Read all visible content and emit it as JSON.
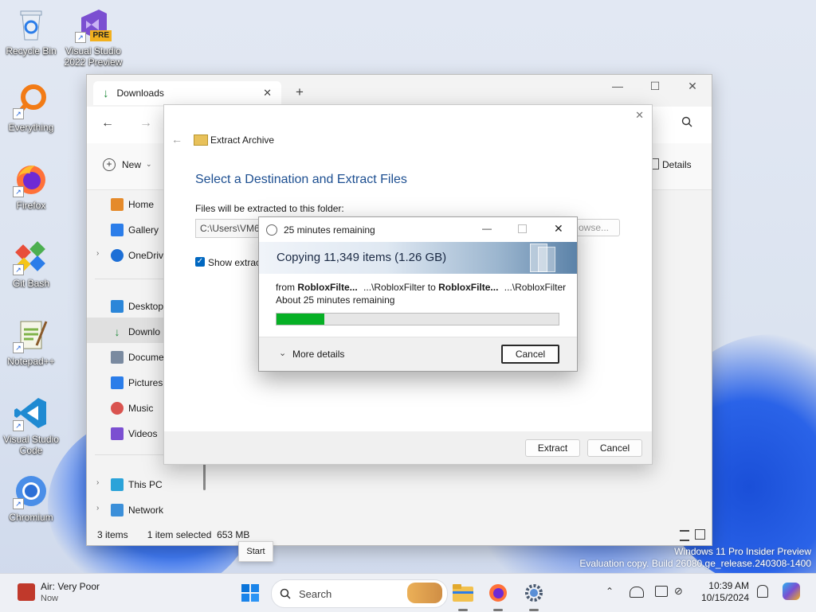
{
  "desktop": {
    "icons": [
      {
        "label": "Recycle Bin"
      },
      {
        "label": "Visual Studio 2022 Preview",
        "badge": "PRE"
      },
      {
        "label": "Everything"
      },
      {
        "label": "Firefox"
      },
      {
        "label": "Git Bash"
      },
      {
        "label": "Notepad++"
      },
      {
        "label": "Visual Studio Code"
      },
      {
        "label": "Chromium"
      }
    ],
    "watermark_line1": "Windows 11 Pro Insider Preview",
    "watermark_line2": "Evaluation copy. Build 26080.ge_release.240308-1400"
  },
  "explorer": {
    "tab_title": "Downloads",
    "new_tab": "+",
    "controls": {
      "minimize": "—",
      "maximize": "☐",
      "close": "✕"
    },
    "new_label": "New",
    "details_label": "Details",
    "sidebar": [
      {
        "label": "Home"
      },
      {
        "label": "Gallery"
      },
      {
        "label": "OneDriv"
      },
      {
        "label": "Desktop"
      },
      {
        "label": "Downlo"
      },
      {
        "label": "Docume"
      },
      {
        "label": "Pictures"
      },
      {
        "label": "Music"
      },
      {
        "label": "Videos"
      },
      {
        "label": "This PC"
      },
      {
        "label": "Network"
      }
    ],
    "status_items": "3 items",
    "status_selected": "1 item selected  653 MB"
  },
  "extract": {
    "title": "Extract Archive",
    "heading": "Select a Destination and Extract Files",
    "folder_label": "Files will be extracted to this folder:",
    "path_value": "C:\\Users\\VM6",
    "browse_label": "owse...",
    "show_label": "Show extract",
    "extract_button": "Extract",
    "cancel_button": "Cancel"
  },
  "copy": {
    "title": "25 minutes remaining",
    "banner": "Copying 11,349 items (1.26 GB)",
    "from_prefix": "from",
    "from_name": "RobloxFilte...",
    "from_path": "...\\RobloxFilter",
    "to_word": "to",
    "to_name": "RobloxFilte...",
    "to_path": "...\\RobloxFilter",
    "remaining": "About 25 minutes remaining",
    "progress": 0.17,
    "more_details": "More details",
    "cancel_button": "Cancel"
  },
  "tooltip": "Start",
  "taskbar": {
    "weather_title": "Air: Very Poor",
    "weather_sub": "Now",
    "search_placeholder": "Search",
    "time": "10:39 AM",
    "date": "10/15/2024"
  },
  "colors": {
    "accent": "#0067c0",
    "progress": "#06b025",
    "taskbar": "#eef0f5"
  }
}
